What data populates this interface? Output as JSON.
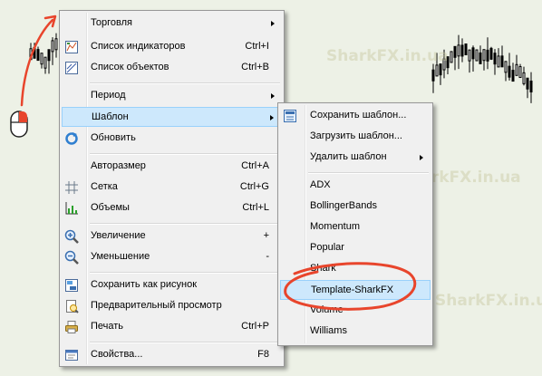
{
  "watermark": "SharkFX.in.ua",
  "main_menu": {
    "items": [
      {
        "label": "Торговля",
        "shortcut": "",
        "icon": "none",
        "submenu": true
      },
      {
        "label": "Список индикаторов",
        "shortcut": "Ctrl+I",
        "icon": "indicators-list-icon",
        "submenu": false
      },
      {
        "label": "Список объектов",
        "shortcut": "Ctrl+B",
        "icon": "objects-list-icon",
        "submenu": false
      },
      {
        "label": "Период",
        "shortcut": "",
        "icon": "none",
        "submenu": true
      },
      {
        "label": "Шаблон",
        "shortcut": "",
        "icon": "none",
        "submenu": true,
        "highlighted": true
      },
      {
        "label": "Обновить",
        "shortcut": "",
        "icon": "refresh-icon",
        "submenu": false
      },
      {
        "label": "Авторазмер",
        "shortcut": "Ctrl+A",
        "icon": "none",
        "submenu": false
      },
      {
        "label": "Сетка",
        "shortcut": "Ctrl+G",
        "icon": "grid-icon",
        "submenu": false
      },
      {
        "label": "Объемы",
        "shortcut": "Ctrl+L",
        "icon": "volumes-icon",
        "submenu": false
      },
      {
        "label": "Увеличение",
        "shortcut": "+",
        "icon": "zoom-in-icon",
        "submenu": false
      },
      {
        "label": "Уменьшение",
        "shortcut": "-",
        "icon": "zoom-out-icon",
        "submenu": false
      },
      {
        "label": "Сохранить как рисунок",
        "shortcut": "",
        "icon": "save-picture-icon",
        "submenu": false
      },
      {
        "label": "Предварительный просмотр",
        "shortcut": "",
        "icon": "print-preview-icon",
        "submenu": false
      },
      {
        "label": "Печать",
        "shortcut": "Ctrl+P",
        "icon": "printer-icon",
        "submenu": false
      },
      {
        "label": "Свойства...",
        "shortcut": "F8",
        "icon": "properties-icon",
        "submenu": false
      }
    ]
  },
  "template_submenu": {
    "items": [
      {
        "label": "Сохранить шаблон...",
        "icon": "save-template-icon",
        "submenu": false
      },
      {
        "label": "Загрузить шаблон...",
        "icon": "none",
        "submenu": false
      },
      {
        "label": "Удалить шаблон",
        "icon": "none",
        "submenu": true
      },
      {
        "label": "ADX",
        "icon": "none",
        "submenu": false
      },
      {
        "label": "BollingerBands",
        "icon": "none",
        "submenu": false
      },
      {
        "label": "Momentum",
        "icon": "none",
        "submenu": false
      },
      {
        "label": "Popular",
        "icon": "none",
        "submenu": false
      },
      {
        "label": "Shark",
        "icon": "none",
        "submenu": false
      },
      {
        "label": "Template-SharkFX",
        "icon": "none",
        "submenu": false,
        "highlighted": true
      },
      {
        "label": "Volume",
        "icon": "none",
        "submenu": false
      },
      {
        "label": "Williams",
        "icon": "none",
        "submenu": false
      }
    ]
  },
  "colors": {
    "chart_background": "#edf1e6",
    "menu_background": "#f0f0f0",
    "highlight_background": "#cde8fc",
    "highlight_border": "#99d1fb",
    "annotation_red": "#e8452c"
  }
}
